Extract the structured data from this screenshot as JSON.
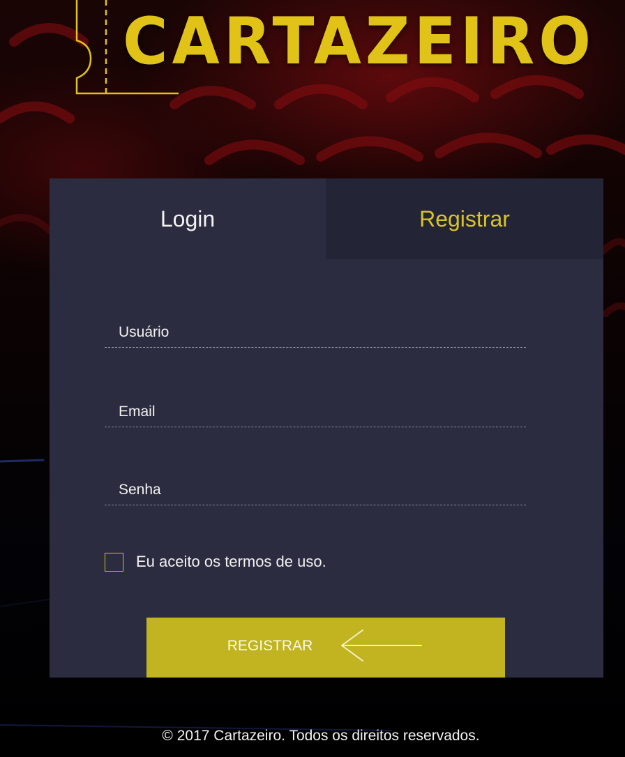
{
  "brand": {
    "name": "CARTAZEIRO",
    "accent_color": "#e1c318",
    "panel_color": "#2b2c3f"
  },
  "tabs": {
    "login": "Login",
    "register": "Registrar",
    "active": "register"
  },
  "form": {
    "username_placeholder": "Usuário",
    "email_placeholder": "Email",
    "password_placeholder": "Senha",
    "terms_label": "Eu aceito os termos de uso.",
    "terms_checked": false,
    "submit_label": "REGISTRAR",
    "submit_icon": "arrow-left-icon"
  },
  "footer": {
    "copyright": "© 2017 Cartazeiro. Todos os direitos reservados."
  }
}
